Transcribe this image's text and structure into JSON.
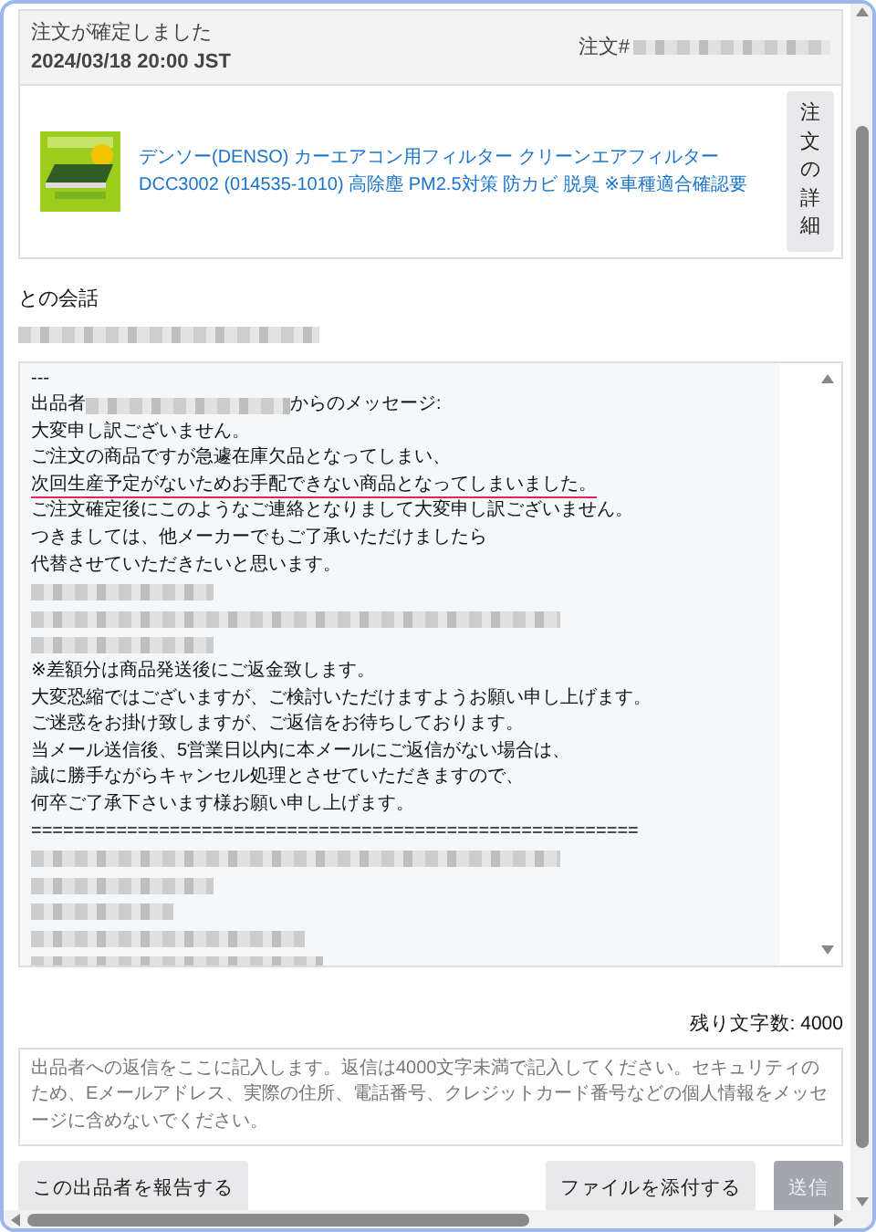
{
  "order": {
    "status": "注文が確定しました",
    "date": "2024/03/18 20:00 JST",
    "number_label": "注文#",
    "product_title": "デンソー(DENSO) カーエアコン用フィルター クリーンエアフィルター DCC3002 (014535-1010) 高除塵 PM2.5対策 防カビ 脱臭 ※車種適合確認要",
    "details_button": "注文の詳細"
  },
  "conversation": {
    "heading": "との会話"
  },
  "message": {
    "lines": [
      {
        "kind": "text",
        "text": "---"
      },
      {
        "kind": "sender",
        "prefix": "出品者",
        "suffix": "からのメッセージ:"
      },
      {
        "kind": "text",
        "text": "大変申し訳ございません。"
      },
      {
        "kind": "text",
        "text": "ご注文の商品ですが急遽在庫欠品となってしまい、"
      },
      {
        "kind": "underlined",
        "text": "次回生産予定がないためお手配できない商品となってしまいました。"
      },
      {
        "kind": "text",
        "text": "ご注文確定後にこのようなご連絡となりまして大変申し訳ございません。"
      },
      {
        "kind": "text",
        "text": "つきましては、他メーカーでもご了承いただけましたら"
      },
      {
        "kind": "text",
        "text": "代替させていただきたいと思います。"
      },
      {
        "kind": "redacted"
      },
      {
        "kind": "redacted"
      },
      {
        "kind": "redacted"
      },
      {
        "kind": "text",
        "text": "  ※差額分は商品発送後にご返金致します。"
      },
      {
        "kind": "text",
        "text": "大変恐縮ではございますが、ご検討いただけますようお願い申し上げます。"
      },
      {
        "kind": "text",
        "text": "ご迷惑をお掛け致しますが、ご返信をお待ちしております。"
      },
      {
        "kind": "text",
        "text": "当メール送信後、5営業日以内に本メールにご返信がない場合は、"
      },
      {
        "kind": "text",
        "text": "誠に勝手ながらキャンセル処理とさせていただきますので、"
      },
      {
        "kind": "text",
        "text": "何卒ご了承下さいます様お願い申し上げます。"
      },
      {
        "kind": "text",
        "text": "========================================================="
      },
      {
        "kind": "redacted"
      },
      {
        "kind": "redacted"
      },
      {
        "kind": "redacted"
      },
      {
        "kind": "redacted"
      },
      {
        "kind": "redacted"
      }
    ]
  },
  "reply": {
    "remaining": "残り文字数: 4000",
    "placeholder": "出品者への返信をここに記入します。返信は4000文字未満で記入してください。セキュリティのため、Eメールアドレス、実際の住所、電話番号、クレジットカード番号などの個人情報をメッセージに含めないでください。"
  },
  "buttons": [
    {
      "kind": "report",
      "label": "この出品者を報告する",
      "disabled": false
    },
    {
      "kind": "attach",
      "label": "ファイルを添付する",
      "disabled": false
    },
    {
      "kind": "send",
      "label": "送信",
      "disabled": true
    }
  ]
}
